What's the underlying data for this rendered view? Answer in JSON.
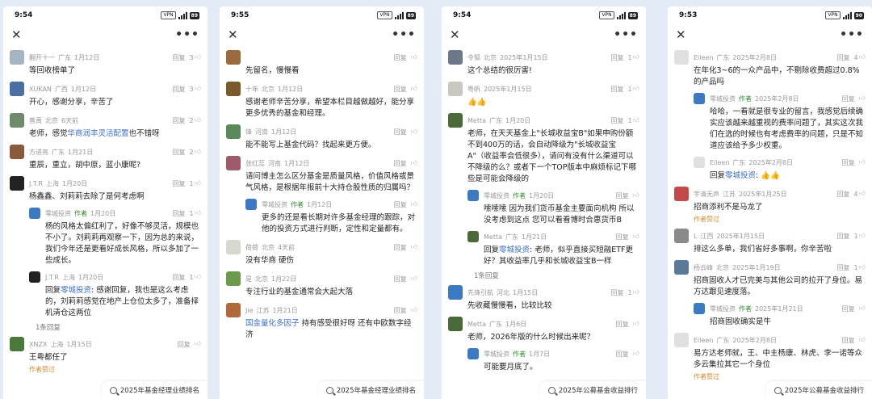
{
  "colors": {
    "author": "#2d8a2d",
    "link": "#3b6fc9",
    "favorite": "#d08a2c"
  },
  "panels": [
    {
      "time": "9:54",
      "battery": "89",
      "search": "2025年基金经理业绩排名",
      "comments": [
        {
          "name": "翻开十一",
          "loc": "广东",
          "date": "1月12日",
          "likes": "3",
          "text": "等回收榜单了",
          "avatar": "#a7b4c2"
        },
        {
          "name": "XUKAN",
          "loc": "广西",
          "date": "1月12日",
          "likes": "3",
          "text": "开心，感谢分享，辛苦了",
          "avatar": "#4b6ea3"
        },
        {
          "name": "普禹",
          "loc": "北京",
          "date": "6天前",
          "likes": "2",
          "text_pre": "老师，感觉",
          "text_link": "华商润丰灵活配置",
          "text_post": "也不错呀",
          "avatar": "#6f8a6a"
        },
        {
          "name": "方进亮",
          "loc": "广东",
          "date": "1月21日",
          "likes": "2",
          "text": "重辰，重立，胡中原，蓝小康呢?",
          "avatar": "#8b5a3c"
        },
        {
          "name": "J.T.R",
          "loc": "上海",
          "date": "1月20日",
          "likes": "1",
          "text": "杨鑫鑫、刘莉莉去除了是何考虑啊",
          "avatar": "#222222",
          "replies": [
            {
              "name": "零城投资",
              "tag": "作者",
              "date": "1月20日",
              "likes": "1",
              "text": "杨的风格太偏红利了，好像不够灵活，规模也不小了。刘莉莉再观察一下，因为总的来说，我们今年还是更看好成长风格，所以多加了一些成长。",
              "avatar": "#3a79c4"
            },
            {
              "name": "J.T.R",
              "loc": "上海",
              "date": "1月20日",
              "likes": "1",
              "text_pre": "回复",
              "text_link": "零城投资",
              "text_post": ": 感谢回复，我也是这么考虑的，刘莉莉感觉在地产上仓位太多了，准备择机清仓这两位",
              "avatar": "#222222"
            }
          ],
          "more": "1条回复"
        },
        {
          "name": "XNZX",
          "loc": "上海",
          "date": "1月15日",
          "likes": "",
          "text": "王粤都任了",
          "avatar": "#4a7a3a",
          "fav": "作者赞过"
        }
      ]
    },
    {
      "time": "9:55",
      "battery": "89",
      "search": "2025年基金经理业绩排名",
      "comments": [
        {
          "name": "",
          "loc": "",
          "date": "",
          "likes": "",
          "text": "先留名，慢慢看",
          "avatar": "#9a6a3c"
        },
        {
          "name": "十年",
          "loc": "北京",
          "date": "1月12日",
          "likes": "",
          "text": "感谢老师辛苦分享，希望本栏目越做越好，能分享更多优秀的基金和经理。",
          "avatar": "#7a5a2a"
        },
        {
          "name": "锋",
          "loc": "河南",
          "date": "1月12日",
          "likes": "",
          "text": "能不能写上基金代码？找起来更方便。",
          "avatar": "#5a8a5a"
        },
        {
          "name": "张红蕊",
          "loc": "河南",
          "date": "1月12日",
          "likes": "",
          "text": "请问博主怎么区分基金是质量风格，价值风格或景气风格，是根据年报前十大持仓股性质的归属吗？",
          "avatar": "#a05a6a",
          "replies": [
            {
              "name": "零城投资",
              "tag": "作者",
              "date": "1月12日",
              "likes": "",
              "text": "更多的还是看长期对许多基金经理的跟踪，对他的投资方式进行判断，定性和定量都有。",
              "avatar": "#3a79c4"
            }
          ]
        },
        {
          "name": "荷荷",
          "loc": "北京",
          "date": "4天前",
          "likes": "",
          "text": "没有华商 硬伤",
          "avatar": "#d8d8d0"
        },
        {
          "name": "是",
          "loc": "北京",
          "date": "1月22日",
          "likes": "",
          "text": "专注行业的基金通常会大起大落",
          "avatar": "#6a9a4a"
        },
        {
          "name": "Jie",
          "loc": "江苏",
          "date": "1月21日",
          "likes": "",
          "text_pre": "",
          "text_link": "国金量化多因子",
          "text_post": " 持有感受很好呀 还有中欧数字经济",
          "avatar": "#b06a3a"
        }
      ]
    },
    {
      "time": "9:54",
      "battery": "89",
      "search": "2025年公募基金收益排行",
      "comments": [
        {
          "name": "令狐",
          "loc": "北京",
          "date": "2025年1月15日",
          "likes": "1",
          "text": "这个总结的很厉害!",
          "avatar": "#6a7a8a"
        },
        {
          "name": "粤帆",
          "loc": "",
          "date": "2025年1月15日",
          "likes": "1",
          "text": "👍👍",
          "avatar": "#c8c8c0"
        },
        {
          "name": "Metta",
          "loc": "广东",
          "date": "1月20日",
          "likes": "1",
          "text": "老师，在天天基金上\"长城收益宝B\"如果申购份额不到400万的话，会自动降级为\"长城收益宝A\"（收益率会低很多），请问有没有什么渠道可以不降级的么？或者下一个TOP版本中麻烦标记下哪些是可能会降级的",
          "avatar": "#4a6a3a",
          "replies": [
            {
              "name": "零城投资",
              "tag": "作者",
              "date": "1月20日",
              "likes": "",
              "text": "嗦嗦嗦 因为我们货币基金主要面向机构 所以没考虑到这点 您可以看看博时合惠货币B",
              "avatar": "#3a79c4"
            },
            {
              "name": "Metta",
              "loc": "广东",
              "date": "1月21日",
              "likes": "",
              "text_pre": "回复",
              "text_link": "零城投资",
              "text_post": ": 老师，似乎直接买短融ETF更好？其收益率几乎和长城收益宝B一样",
              "avatar": "#4a6a3a"
            }
          ],
          "more": "1条回复"
        },
        {
          "name": "先锋引航",
          "loc": "河北",
          "date": "1月15日",
          "likes": "1",
          "text": "先收藏慢慢看，比较比较",
          "avatar": "#3a7ac4"
        },
        {
          "name": "Metta",
          "loc": "广东",
          "date": "1月6日",
          "likes": "",
          "text": "老师，2026年版的什么时候出来呢？",
          "avatar": "#4a6a3a",
          "replies": [
            {
              "name": "零城投资",
              "tag": "作者",
              "date": "1月7日",
              "likes": "",
              "text": "可能要月底了。",
              "avatar": "#3a79c4"
            }
          ]
        }
      ]
    },
    {
      "time": "9:53",
      "battery": "90",
      "search": "2025年公募基金收益排行",
      "comments": [
        {
          "name": "Eileen",
          "loc": "广东",
          "date": "2025年2月8日",
          "likes": "4",
          "text": "在年化3~6的一众产品中，不剔除收费超过0.8%的产品吗",
          "avatar": "#e0e0e0",
          "replies": [
            {
              "name": "零城投资",
              "tag": "作者",
              "date": "2025年2月8日",
              "likes": "",
              "text": "哈哈，一看就是很专业的留言，我感觉后续确实应该越来越重视的费率问题了，其实这次我们在选的时候也有考虑费率的问题，只是不知道应该给予多少权重。",
              "avatar": "#3a79c4"
            },
            {
              "name": "Eileen",
              "loc": "广东",
              "date": "2025年2月8日",
              "likes": "",
              "text_pre": "回复",
              "text_link": "零城投资",
              "text_post": ": 👍👍",
              "avatar": "#e0e0e0"
            }
          ]
        },
        {
          "name": "宇清无声",
          "loc": "江苏",
          "date": "2025年1月25日",
          "likes": "4",
          "text": "招商添利不是马龙了",
          "avatar": "#c44a4a",
          "fav": "作者赞过"
        },
        {
          "name": "L",
          "loc": "江西",
          "date": "2025年1月15日",
          "likes": "1",
          "text": "排这么多单，我们省好多事啊，你辛苦啦",
          "avatar": "#8a8a8a"
        },
        {
          "name": "杨云峰",
          "loc": "北京",
          "date": "2025年1月19日",
          "likes": "1",
          "text": "招商固收人才已完美与其他公司的拉开了身位。易方达跟见速度落。",
          "avatar": "#5a7a9a",
          "replies": [
            {
              "name": "零城投资",
              "tag": "作者",
              "date": "2025年1月21日",
              "likes": "",
              "text": "招商固收确实是牛",
              "avatar": "#3a79c4"
            }
          ]
        },
        {
          "name": "Eileen",
          "loc": "广东",
          "date": "2025年2月8日",
          "likes": "",
          "text": "易方达老师就，王、中主杨康、林虎、李一诺等众多云集拉其它一个身位",
          "avatar": "#e0e0e0",
          "fav": "作者赞过"
        }
      ]
    }
  ],
  "labels": {
    "reply": "回复",
    "author_liked": "作者赞过"
  }
}
